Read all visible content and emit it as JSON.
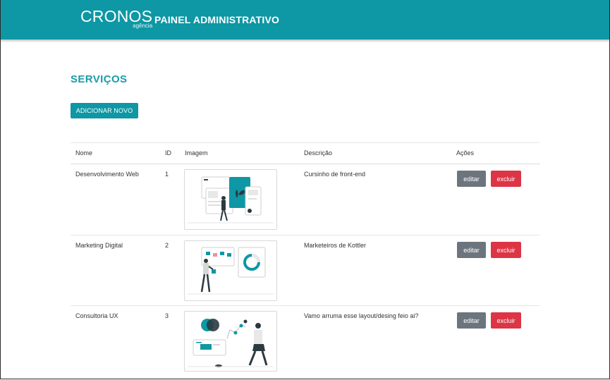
{
  "header": {
    "logo_main": "CRONOS",
    "logo_sub": "agência",
    "title": "PAINEL ADMINISTRATIVO"
  },
  "page": {
    "title": "SERVIÇOS",
    "add_button_label": "ADICIONAR NOVO"
  },
  "table": {
    "columns": [
      "Nome",
      "ID",
      "Imagem",
      "Descrição",
      "Ações"
    ],
    "rows": [
      {
        "name": "Desenvolvimento Web",
        "id": "1",
        "description": "Cursinho de front-end",
        "image_icon": "web-development-illustration"
      },
      {
        "name": "Marketing Digital",
        "id": "2",
        "description": "Marketeiros de Kottler",
        "image_icon": "marketing-illustration"
      },
      {
        "name": "Consultoria UX",
        "id": "3",
        "description": "Vamo arruma esse layout/desing feio ai?",
        "image_icon": "ux-consulting-illustration"
      }
    ],
    "edit_label": "editar",
    "delete_label": "excluir"
  },
  "colors": {
    "brand": "#0e97a4",
    "edit": "#6c757d",
    "delete": "#dc3545"
  }
}
